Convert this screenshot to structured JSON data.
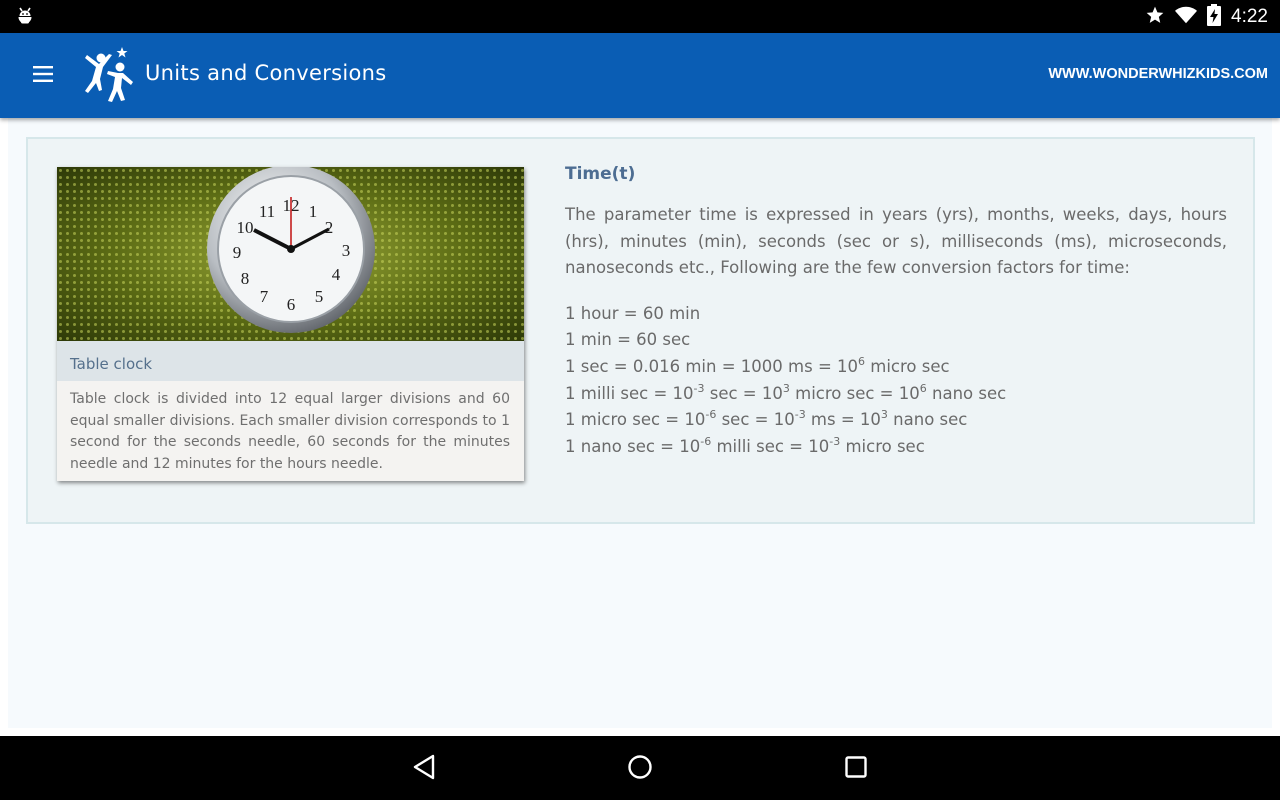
{
  "status_bar": {
    "time": "4:22",
    "icons": [
      "android-debug-icon",
      "star-icon",
      "wifi-icon",
      "battery-charging-icon"
    ]
  },
  "app_bar": {
    "title": "Units and Conversions",
    "site_link": "WWW.WONDERWHIZKIDS.COM",
    "background_color": "#0a5db4"
  },
  "figure": {
    "image_name": "table-clock-photo",
    "caption_title": "Table clock",
    "caption_body": "Table clock is divided into 12 equal larger divisions and 60 equal smaller divisions. Each smaller division corresponds to 1 second for the seconds needle, 60 seconds for the minutes needle and 12 minutes for the hours needle."
  },
  "section": {
    "title": "Time(t)",
    "paragraph": "The parameter time is expressed in years (yrs), months, weeks, days, hours (hrs), minutes (min), seconds (sec or s), milliseconds (ms), microseconds, nanoseconds etc., Following are the few conversion factors for time:",
    "conversions": [
      {
        "parts": [
          {
            "t": "1 hour = 60 min"
          }
        ]
      },
      {
        "parts": [
          {
            "t": "1 min = 60 sec"
          }
        ]
      },
      {
        "parts": [
          {
            "t": "1 sec = 0.016 min = 1000 ms = 10"
          },
          {
            "sup": "6"
          },
          {
            "t": " micro sec"
          }
        ]
      },
      {
        "parts": [
          {
            "t": "1 milli sec = 10"
          },
          {
            "sup": "-3"
          },
          {
            "t": " sec = 10"
          },
          {
            "sup": "3"
          },
          {
            "t": " micro sec = 10"
          },
          {
            "sup": "6"
          },
          {
            "t": " nano sec"
          }
        ]
      },
      {
        "parts": [
          {
            "t": "1 micro sec = 10"
          },
          {
            "sup": "-6"
          },
          {
            "t": " sec = 10"
          },
          {
            "sup": "-3"
          },
          {
            "t": " ms = 10"
          },
          {
            "sup": "3"
          },
          {
            "t": " nano sec"
          }
        ]
      },
      {
        "parts": [
          {
            "t": "1 nano sec = 10"
          },
          {
            "sup": "-6"
          },
          {
            "t": " milli sec = 10"
          },
          {
            "sup": "-3"
          },
          {
            "t": " micro sec"
          }
        ]
      }
    ]
  },
  "nav_bar": {
    "buttons": [
      "back-icon",
      "home-icon",
      "recents-icon"
    ]
  },
  "colors": {
    "accent": "#0a5db4",
    "title_text": "#4d6d92",
    "body_text": "#6a6a6a",
    "panel_bg": "#eef4f6"
  }
}
